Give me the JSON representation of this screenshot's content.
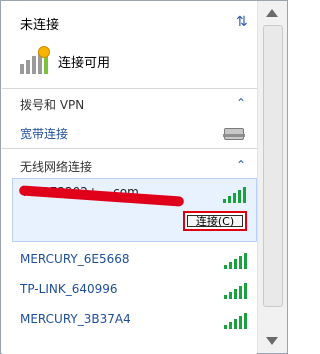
{
  "header": {
    "title": "未连接",
    "status": "连接可用"
  },
  "sections": {
    "dial_vpn": "拨号和 VPN",
    "broadband": "宽带连接",
    "wireless": "无线网络连接"
  },
  "wifi": {
    "selected_ssid": "h        7073202+   ,        .com",
    "connect_label": "连接(C)",
    "networks": [
      {
        "ssid": "MERCURY_6E5668"
      },
      {
        "ssid": "TP-LINK_640996"
      },
      {
        "ssid": "MERCURY_3B37A4"
      }
    ]
  },
  "icons": {
    "refresh": "refresh-icon",
    "collapse": "chevron-up-icon",
    "network": "network-status-icon",
    "modem": "modem-icon",
    "wifi_bars": "wifi-signal-icon"
  },
  "colors": {
    "link": "#1f4e9b",
    "redaction": "#e0001a",
    "selection_bg": "#e8f2ff",
    "selection_border": "#b8d1f4",
    "signal_green": "#1aa23f"
  }
}
